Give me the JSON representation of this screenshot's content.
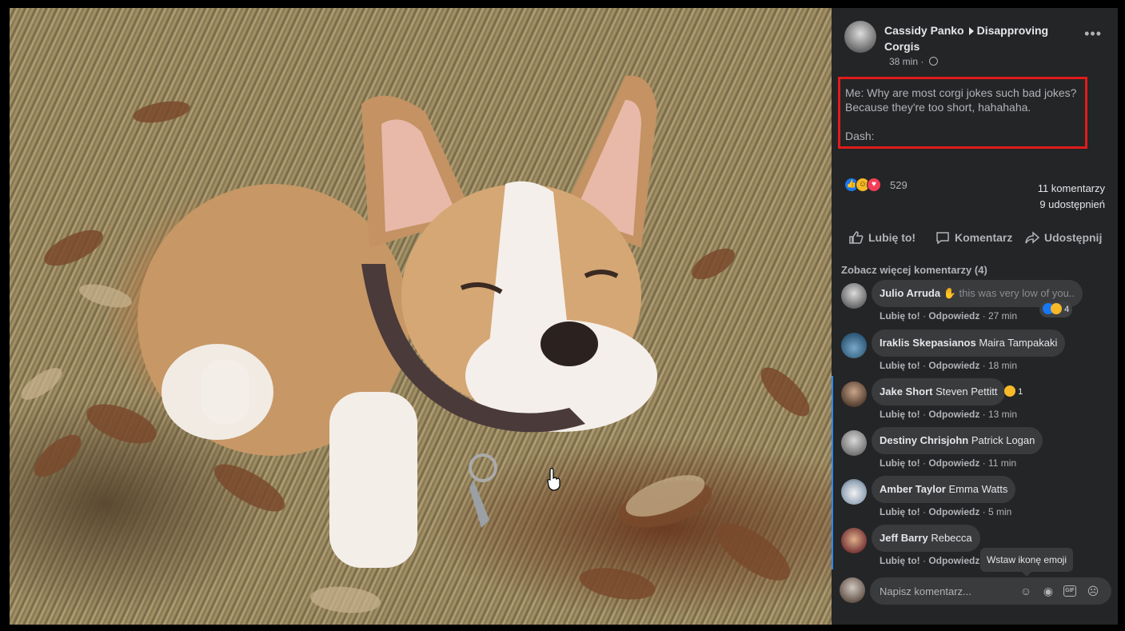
{
  "post": {
    "author": "Cassidy Panko",
    "group": "Disapproving Corgis",
    "time": "38 min",
    "text_line1": "Me: Why are most corgi jokes such bad jokes?",
    "text_line2": "Because they're too short, hahahaha.",
    "text_line3": "Dash:",
    "reaction_count": "529",
    "comments_count": "11 komentarzy",
    "shares_count": "9 udostępnień"
  },
  "actions": {
    "like": "Lubię to!",
    "comment": "Komentarz",
    "share": "Udostępnij"
  },
  "see_more": "Zobacz więcej komentarzy (4)",
  "comments": [
    {
      "name": "Julio Arruda",
      "text": "this was very low of you..",
      "like": "Lubię to!",
      "reply": "Odpowiedz",
      "time": "27 min",
      "reactions": "4"
    },
    {
      "name": "Iraklis Skepasianos",
      "text": "Maira Tampakaki",
      "like": "Lubię to!",
      "reply": "Odpowiedz",
      "time": "18 min"
    },
    {
      "name": "Jake Short",
      "text": "Steven Pettitt",
      "like": "Lubię to!",
      "reply": "Odpowiedz",
      "time": "13 min",
      "reactions": "1"
    },
    {
      "name": "Destiny Chrisjohn",
      "text": "Patrick Logan",
      "like": "Lubię to!",
      "reply": "Odpowiedz",
      "time": "11 min"
    },
    {
      "name": "Amber Taylor",
      "text": "Emma Watts",
      "like": "Lubię to!",
      "reply": "Odpowiedz",
      "time": "5 min"
    },
    {
      "name": "Jeff Barry",
      "text": "Rebecca",
      "like": "Lubię to!",
      "reply": "Odpowiedz"
    }
  ],
  "tooltip": "Wstaw ikonę emoji",
  "composer": {
    "placeholder": "Napisz komentarz..."
  },
  "icons": {
    "reaction_like": "like-icon",
    "reaction_haha": "haha-icon",
    "reaction_love": "love-icon"
  },
  "colors": {
    "highlight": "#e01c1c",
    "panel": "#242526",
    "bubble": "#3a3b3c",
    "accent": "#2d88ff"
  }
}
